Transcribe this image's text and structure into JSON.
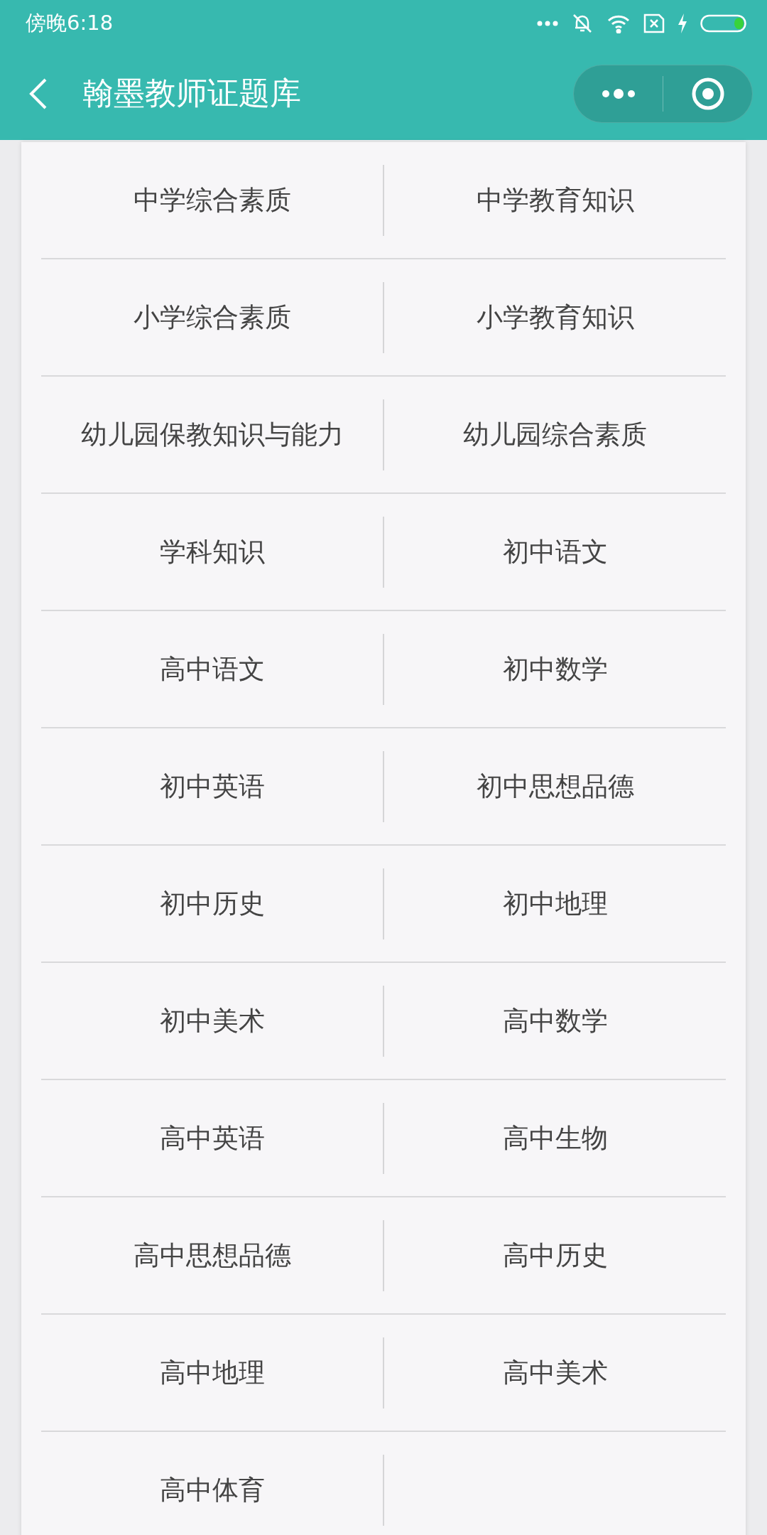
{
  "status_bar": {
    "time": "傍晚6:18"
  },
  "header": {
    "title": "翰墨教师证题库"
  },
  "subjects": [
    "中学综合素质",
    "中学教育知识",
    "小学综合素质",
    "小学教育知识",
    "幼儿园保教知识与能力",
    "幼儿园综合素质",
    "学科知识",
    "初中语文",
    "高中语文",
    "初中数学",
    "初中英语",
    "初中思想品德",
    "初中历史",
    "初中地理",
    "初中美术",
    "高中数学",
    "高中英语",
    "高中生物",
    "高中思想品德",
    "高中历史",
    "高中地理",
    "高中美术",
    "高中体育"
  ]
}
